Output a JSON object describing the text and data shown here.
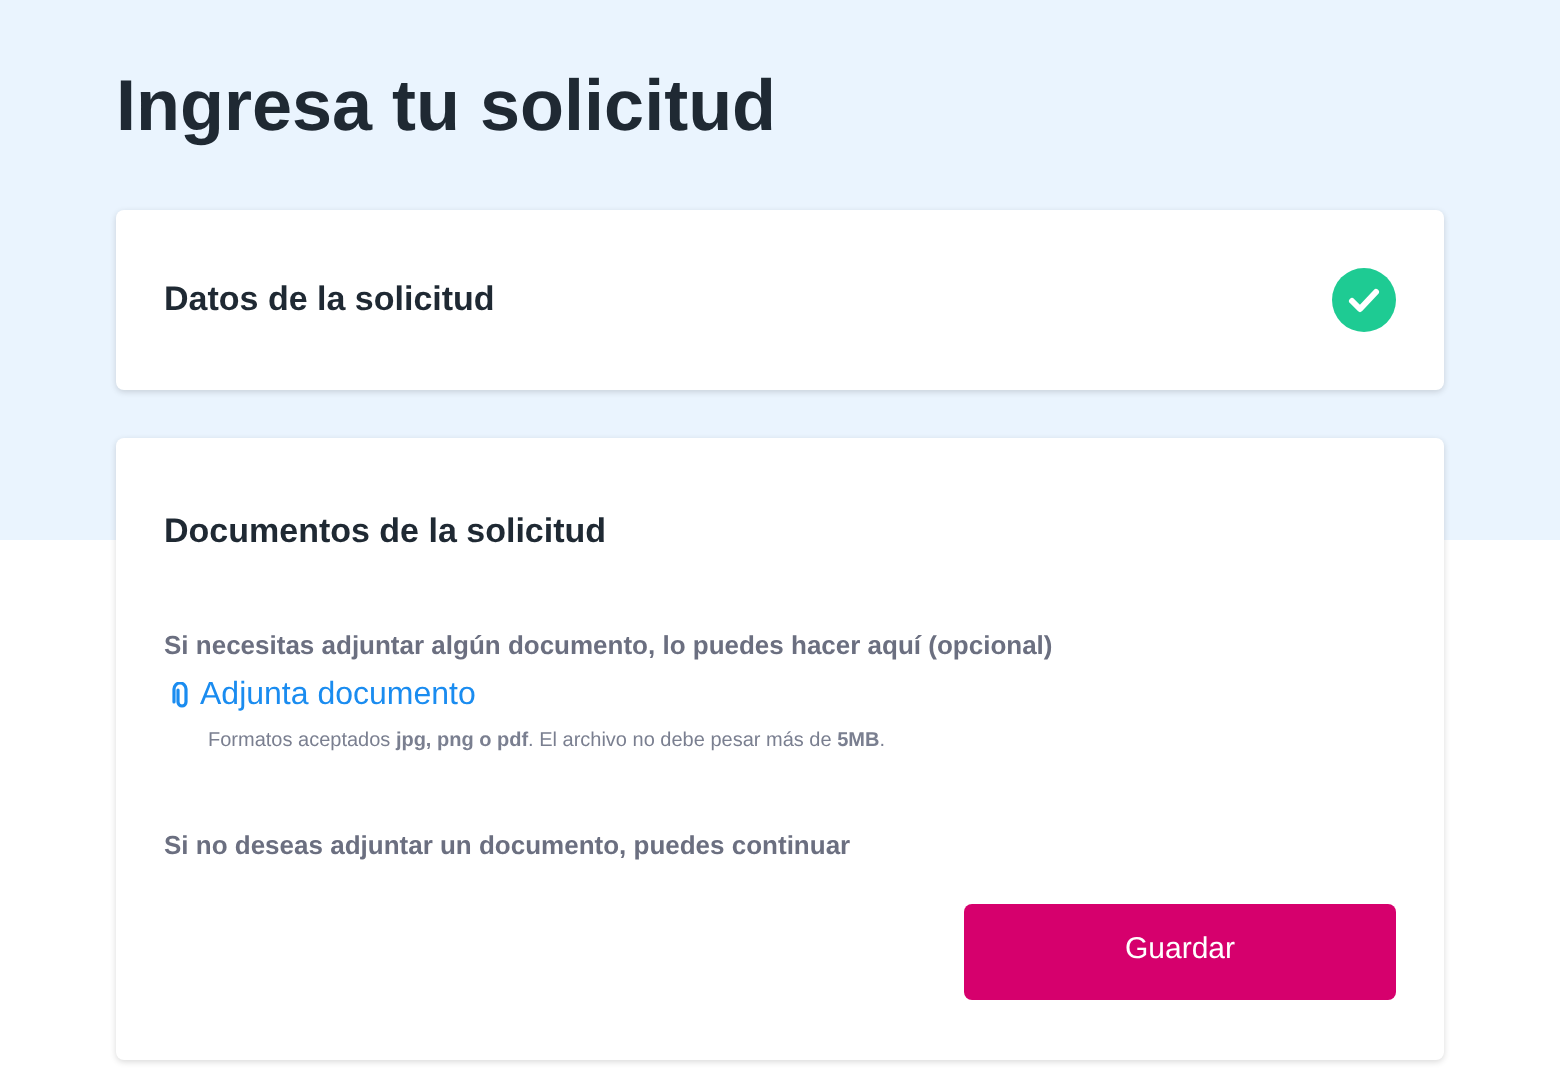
{
  "page_title": "Ingresa tu solicitud",
  "summary_card": {
    "title": "Datos de la solicitud",
    "completed": true
  },
  "documents_card": {
    "title": "Documentos de la solicitud",
    "instruction": "Si necesitas adjuntar algún documento, lo puedes hacer aquí (opcional)",
    "attach_link": "Adjunta documento",
    "formats_note": "Formatos aceptados **jpg, png o pdf**. El archivo no debe pesar más de **5MB**.",
    "continue_text": "Si no deseas adjuntar un documento, puedes continuar",
    "button": "Guardar"
  }
}
